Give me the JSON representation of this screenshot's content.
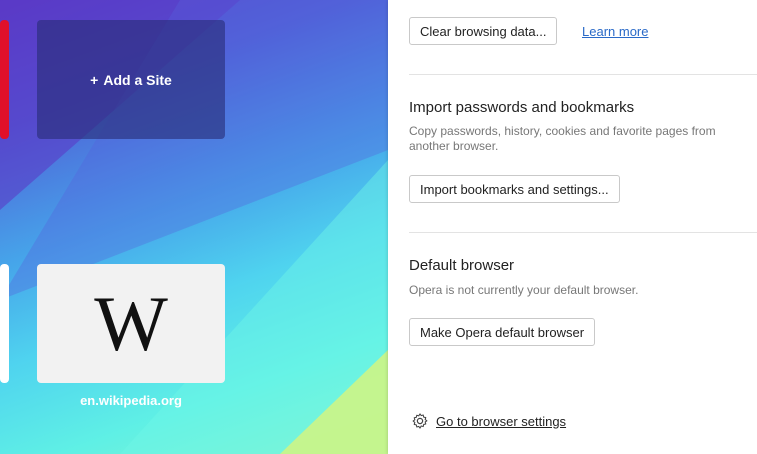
{
  "speed_dial": {
    "add_site_label": "Add a Site",
    "add_site_icon": "+",
    "wiki_glyph": "W",
    "wiki_label": "en.wikipedia.org"
  },
  "panel": {
    "clear_browsing_button": "Clear browsing data...",
    "learn_more_link": "Learn more",
    "import_heading": "Import passwords and bookmarks",
    "import_desc": "Copy passwords, history, cookies and favorite pages from another browser.",
    "import_button": "Import bookmarks and settings...",
    "default_heading": "Default browser",
    "default_desc": "Opera is not currently your default browser.",
    "default_button": "Make Opera default browser",
    "settings_link": "Go to browser settings",
    "icons": {
      "settings": "gear-icon",
      "add": "plus-icon"
    }
  },
  "colors": {
    "accent_link": "#2a6ac8",
    "red_tile": "#e0102a"
  }
}
